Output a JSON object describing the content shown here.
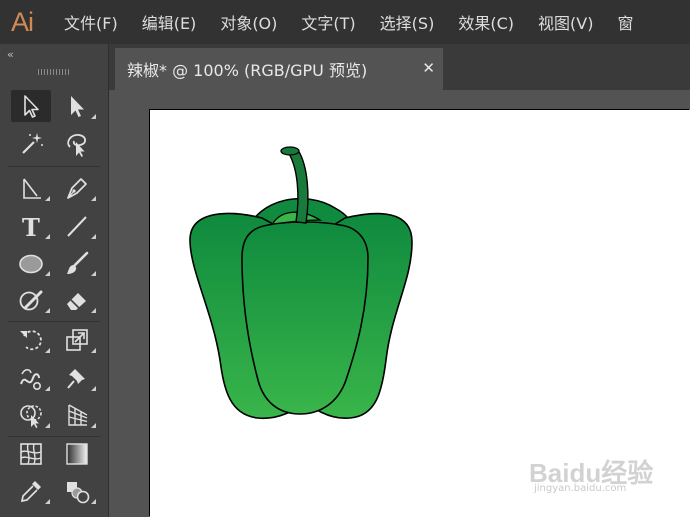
{
  "app": {
    "logo_text": "Ai",
    "brand_color": "#d08a54"
  },
  "menu": {
    "items": [
      {
        "label": "文件(F)"
      },
      {
        "label": "编辑(E)"
      },
      {
        "label": "对象(O)"
      },
      {
        "label": "文字(T)"
      },
      {
        "label": "选择(S)"
      },
      {
        "label": "效果(C)"
      },
      {
        "label": "视图(V)"
      },
      {
        "label": "窗"
      }
    ]
  },
  "toolbar": {
    "collapse_glyph": "‹‹",
    "tools": [
      {
        "icon": "selection-arrow-icon",
        "active": true
      },
      {
        "icon": "direct-selection-arrow-icon"
      },
      {
        "icon": "magic-wand-icon"
      },
      {
        "icon": "lasso-icon"
      },
      {
        "icon": "pen-anchor-icon"
      },
      {
        "icon": "pen-icon"
      },
      {
        "icon": "type-icon",
        "label": "T"
      },
      {
        "icon": "line-segment-icon"
      },
      {
        "icon": "ellipse-icon"
      },
      {
        "icon": "paintbrush-icon"
      },
      {
        "icon": "shaper-icon"
      },
      {
        "icon": "eraser-icon"
      },
      {
        "icon": "rotate-icon"
      },
      {
        "icon": "scale-icon"
      },
      {
        "icon": "warp-icon"
      },
      {
        "icon": "pin-icon"
      },
      {
        "icon": "shape-builder-icon"
      },
      {
        "icon": "perspective-grid-icon"
      },
      {
        "icon": "mesh-icon"
      },
      {
        "icon": "gradient-icon"
      },
      {
        "icon": "eyedropper-icon"
      },
      {
        "icon": "blend-icon"
      }
    ]
  },
  "document": {
    "tab_title": "辣椒* @ 100% (RGB/GPU 预览)",
    "close_glyph": "✕"
  },
  "artwork": {
    "pepper_dark": "#0f8a3e",
    "pepper_light": "#39b54a",
    "stem_color": "#1a7a3c"
  },
  "watermark": {
    "brand": "Baidu经验",
    "url": "jingyan.baidu.com"
  }
}
